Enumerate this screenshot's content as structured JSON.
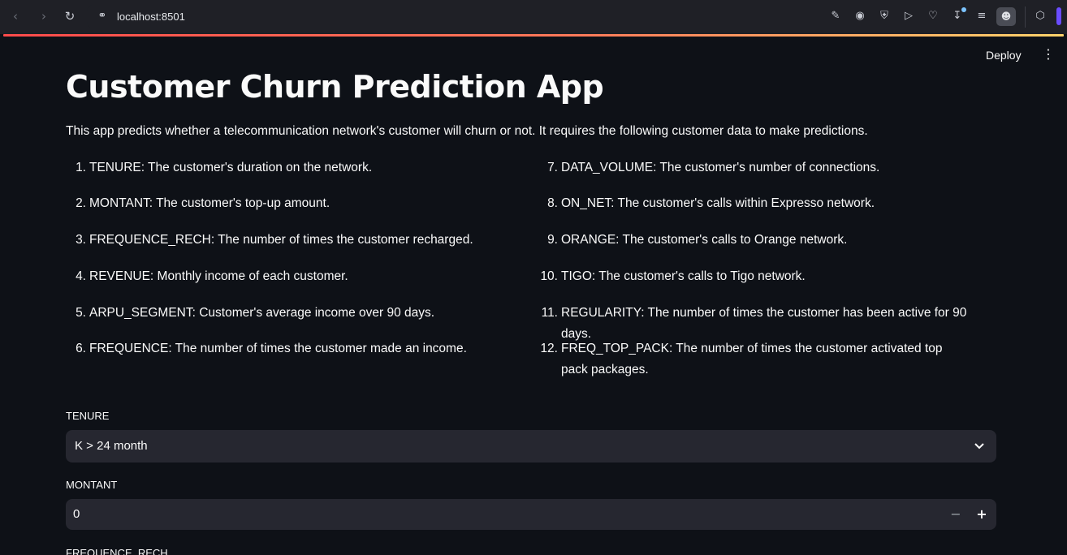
{
  "browser": {
    "url": "localhost:8501",
    "icons": [
      "back-icon",
      "forward-icon",
      "reload-icon",
      "site-info-icon",
      "edit-icon",
      "camera-icon",
      "shield-icon",
      "send-icon",
      "heart-icon",
      "download-icon",
      "menu-icon",
      "profile-icon",
      "extension-icon"
    ]
  },
  "header": {
    "deploy_label": "Deploy",
    "menu_icon": "more-vertical-icon"
  },
  "main": {
    "title": "Customer Churn Prediction App",
    "intro": "This app predicts whether a telecommunication network's customer will churn or not. It requires the following customer data to make predictions.",
    "features_left": [
      {
        "num": "1.",
        "text": "TENURE: The customer's duration on the network."
      },
      {
        "num": "2.",
        "text": "MONTANT: The customer's top-up amount."
      },
      {
        "num": "3.",
        "text": "FREQUENCE_RECH: The number of times the customer recharged."
      },
      {
        "num": "4.",
        "text": "REVENUE: Monthly income of each customer."
      },
      {
        "num": "5.",
        "text": "ARPU_SEGMENT: Customer's average income over 90 days."
      },
      {
        "num": "6.",
        "text": "FREQUENCE: The number of times the customer made an income."
      }
    ],
    "features_right": [
      {
        "num": "7.",
        "text": "DATA_VOLUME: The customer's number of connections."
      },
      {
        "num": "8.",
        "text": "ON_NET: The customer's calls within Expresso network."
      },
      {
        "num": "9.",
        "text": "ORANGE: The customer's calls to Orange network."
      },
      {
        "num": "10.",
        "text": "TIGO: The customer's calls to Tigo network."
      },
      {
        "num": "11.",
        "text": "REGULARITY: The number of times the customer has been active for 90 days."
      },
      {
        "num": "12.",
        "text": "FREQ_TOP_PACK: The number of times the customer activated top pack packages."
      }
    ]
  },
  "form": {
    "tenure": {
      "label": "TENURE",
      "value": "K > 24 month"
    },
    "montant": {
      "label": "MONTANT",
      "value": "0",
      "minus": "−",
      "plus": "+"
    },
    "frequence_rech": {
      "label": "FREQUENCE_RECH"
    }
  },
  "colors": {
    "background": "#0e1117",
    "input_bg": "#262730",
    "accent": "#ff4b4b"
  }
}
